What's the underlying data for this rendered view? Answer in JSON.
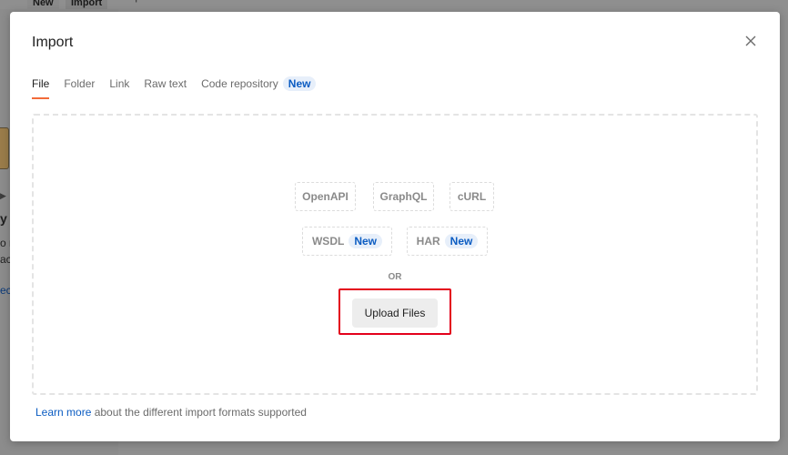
{
  "background": {
    "tabs": [
      "New",
      "Import"
    ],
    "plus_icon": "+",
    "dots_icon": "∘∘∘",
    "fragments": [
      "y",
      "o r",
      "ac",
      "ect"
    ]
  },
  "modal": {
    "title": "Import",
    "close_icon": "close-icon",
    "tabs": [
      {
        "label": "File",
        "active": true
      },
      {
        "label": "Folder"
      },
      {
        "label": "Link"
      },
      {
        "label": "Raw text"
      },
      {
        "label": "Code repository",
        "badge": "New"
      }
    ],
    "formats_row1": [
      {
        "label": "OpenAPI"
      },
      {
        "label": "GraphQL"
      },
      {
        "label": "cURL"
      }
    ],
    "formats_row2": [
      {
        "label": "WSDL",
        "badge": "New"
      },
      {
        "label": "HAR",
        "badge": "New"
      }
    ],
    "or_text": "OR",
    "upload_button": "Upload Files",
    "footer": {
      "link_text": "Learn more",
      "text": " about the different import formats supported"
    }
  },
  "colors": {
    "accent_tab": "#f26b3a",
    "badge_text": "#0b5cc2",
    "badge_bg": "#e7effa",
    "highlight": "#e3001b"
  }
}
